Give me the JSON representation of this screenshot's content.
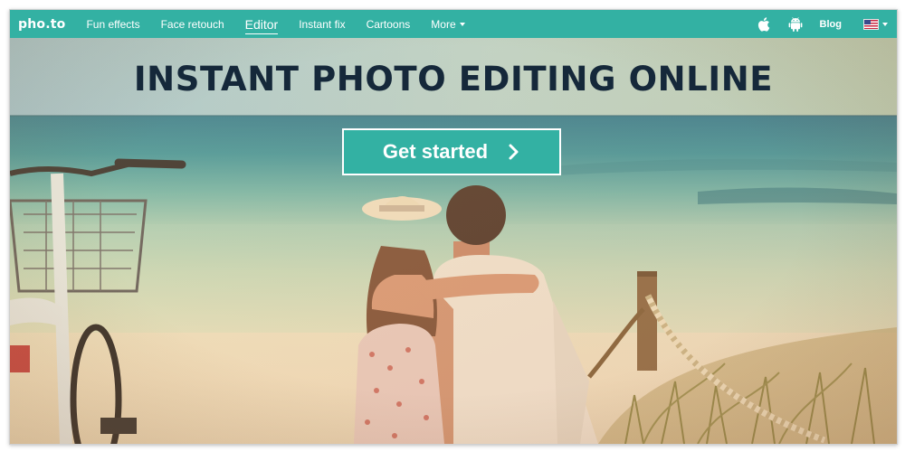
{
  "nav": {
    "logo": "pho.to",
    "items": [
      {
        "label": "Fun effects"
      },
      {
        "label": "Face retouch"
      },
      {
        "label": "Editor"
      },
      {
        "label": "Instant fix"
      },
      {
        "label": "Cartoons"
      },
      {
        "label": "More"
      }
    ],
    "active_item": "Editor",
    "blog_label": "Blog",
    "icons": [
      "apple-icon",
      "android-icon"
    ],
    "language_icon": "us-flag-icon"
  },
  "hero": {
    "title": "INSTANT PHOTO EDITING ONLINE",
    "cta_label": "Get started",
    "cta_icon": "chevron-right-icon"
  },
  "colors": {
    "brand": "#33b1a3",
    "title_text": "#15283a"
  }
}
